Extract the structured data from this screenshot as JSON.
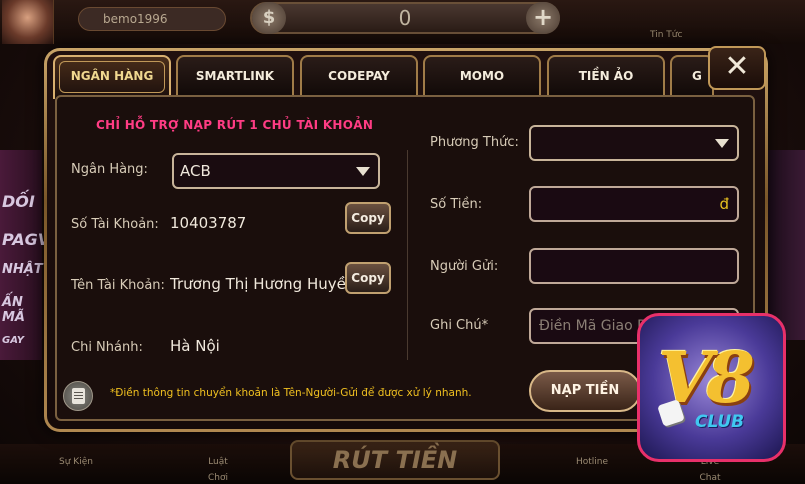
{
  "topbar": {
    "username": "bemo1996",
    "balance": "0",
    "dollar_icon": "$",
    "plus_icon": "+",
    "news_label": "Tin Tức"
  },
  "background": {
    "left_banner": [
      "DỐI",
      "PAGV",
      "NHẬT",
      "ẤN MÃ",
      "GAY"
    ],
    "bottom_buttons": [
      "Sự Kiện",
      "Luật Chơi",
      "Hotline",
      "Live Chat"
    ],
    "withdraw_label": "RÚT TIỀN"
  },
  "tabs": [
    {
      "label": "NGÂN HÀNG",
      "active": true
    },
    {
      "label": "SMARTLINK",
      "active": false
    },
    {
      "label": "CODEPAY",
      "active": false
    },
    {
      "label": "MOMO",
      "active": false
    },
    {
      "label": "TIỀN ẢO",
      "active": false
    },
    {
      "label": "G",
      "active": false
    }
  ],
  "close_icon": "✕",
  "bank_info": {
    "support_note": "CHỈ HỖ TRỢ NẠP RÚT 1 CHỦ TÀI KHOẢN",
    "bank_label": "Ngân Hàng:",
    "bank_value": "ACB",
    "account_number_label": "Số Tài Khoản:",
    "account_number": "10403787",
    "account_name_label": "Tên Tài Khoản:",
    "account_name": "Trương Thị Hương Huyền",
    "branch_label": "Chi Nhánh:",
    "branch_value": "Hà Nội",
    "copy_label": "Copy"
  },
  "deposit_form": {
    "method_label": "Phương Thức:",
    "method_value": "",
    "amount_label": "Số Tiền:",
    "amount_currency": "đ",
    "sender_label": "Người Gửi:",
    "note_label": "Ghi Chú*",
    "note_placeholder": "Điền Mã Giao Dịch",
    "submit_label": "NẠP TIỀN"
  },
  "info_text": "*Điền thông tin chuyển khoản là Tên-Người-Gửi để được xử lý nhanh.",
  "logo": {
    "main": "V8",
    "sub": "CLUB"
  },
  "colors": {
    "accent_gold": "#c8a468",
    "warning_pink": "#ff3c84",
    "info_yellow": "#f0c020"
  }
}
